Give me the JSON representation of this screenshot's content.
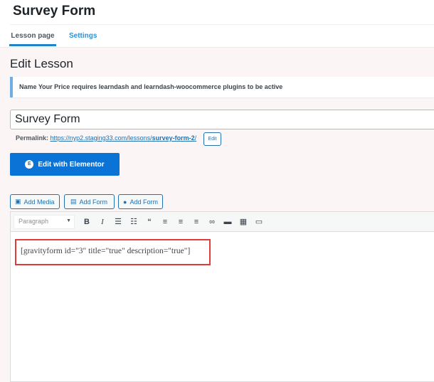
{
  "header": {
    "title": "Survey Form",
    "tabs": [
      {
        "label": "Lesson page",
        "active": true
      },
      {
        "label": "Settings",
        "active": false
      }
    ]
  },
  "page": {
    "heading": "Edit Lesson",
    "notice": "Name Your Price requires learndash and learndash-woocommerce plugins to be active"
  },
  "post": {
    "title_value": "Survey Form",
    "permalink_label": "Permalink:",
    "permalink_base": "https://nyp2.staging33.com/lessons/",
    "permalink_slug": "survey-form-2",
    "permalink_trail": "/",
    "edit_label": "Edit"
  },
  "elementor": {
    "label": "Edit with Elementor",
    "icon": "E"
  },
  "media_buttons": [
    {
      "label": "Add Media",
      "icon": "media-icon"
    },
    {
      "label": "Add Form",
      "icon": "form-icon"
    },
    {
      "label": "Add Form",
      "icon": "form-circle-icon"
    }
  ],
  "toolbar": {
    "format": "Paragraph",
    "buttons": [
      "bold",
      "italic",
      "bullet-list",
      "numbered-list",
      "blockquote",
      "align-left",
      "align-center",
      "align-right",
      "link",
      "read-more",
      "toolbar-toggle",
      "fullscreen"
    ]
  },
  "editor": {
    "content": "[gravityform id=\"3\" title=\"true\" description=\"true\"]",
    "highlight_color": "#e03c3c"
  },
  "colors": {
    "accent": "#0c73d6",
    "link": "#2271b1",
    "notice_border": "#72aee6"
  }
}
